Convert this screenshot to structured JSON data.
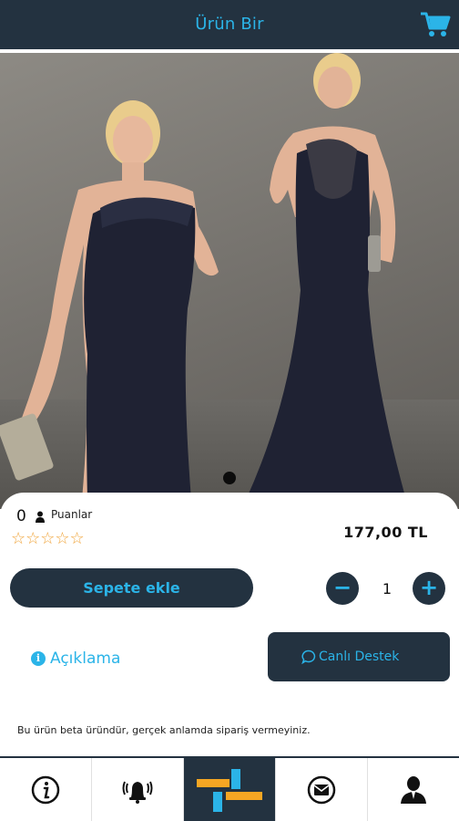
{
  "header": {
    "title": "Ürün Bir",
    "cart_icon": "shopping-cart-icon"
  },
  "gallery": {
    "image_alt": "product-photo",
    "active_slide": 1
  },
  "product": {
    "rating_count": "0",
    "rating_label": "Puanlar",
    "stars": "☆☆☆☆☆",
    "star_value": 0,
    "price": "177,00 TL"
  },
  "actions": {
    "add_to_cart_label": "Sepete ekle",
    "quantity": "1",
    "minus_label": "−",
    "plus_label": "+"
  },
  "tabs": {
    "description_label": "Açıklama",
    "info_glyph": "i"
  },
  "support": {
    "label": "Canlı Destek"
  },
  "note": "Bu ürün beta üründür, gerçek anlamda sipariş vermeyiniz.",
  "bottom_nav": [
    {
      "icon": "info-icon",
      "active": false
    },
    {
      "icon": "notification-bell-icon",
      "active": false
    },
    {
      "icon": "grid-logo-icon",
      "active": true
    },
    {
      "icon": "mail-icon",
      "active": false
    },
    {
      "icon": "user-icon",
      "active": false
    }
  ],
  "colors": {
    "primary": "#233240",
    "accent": "#2bb4e8",
    "star": "#f0a43a",
    "logo_orange": "#f5a623"
  }
}
